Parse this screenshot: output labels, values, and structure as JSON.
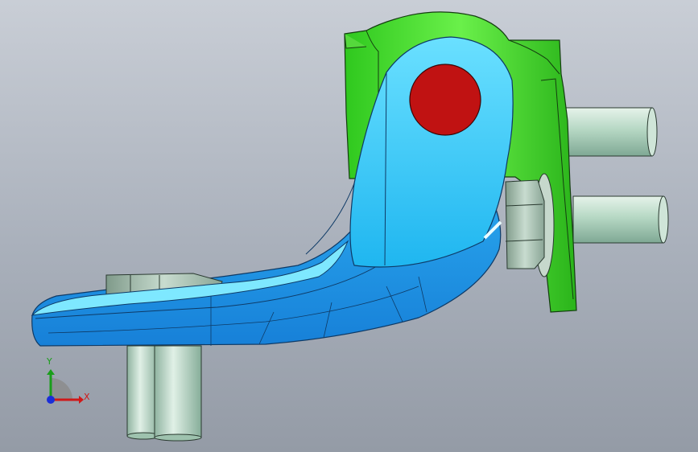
{
  "viewport": {
    "colors": {
      "bracket": "#1ec8f5",
      "bracket_dark": "#1a8ee0",
      "clamp": "#3ee22a",
      "pin": "#c01212",
      "pins_cyl": "#b4d6c4",
      "nut": "#9fb6a8"
    }
  },
  "triad": {
    "x_label": "X",
    "y_label": "Y",
    "x_color": "#d01818",
    "y_color": "#1a9e1a",
    "z_color": "#1a2ed8"
  }
}
